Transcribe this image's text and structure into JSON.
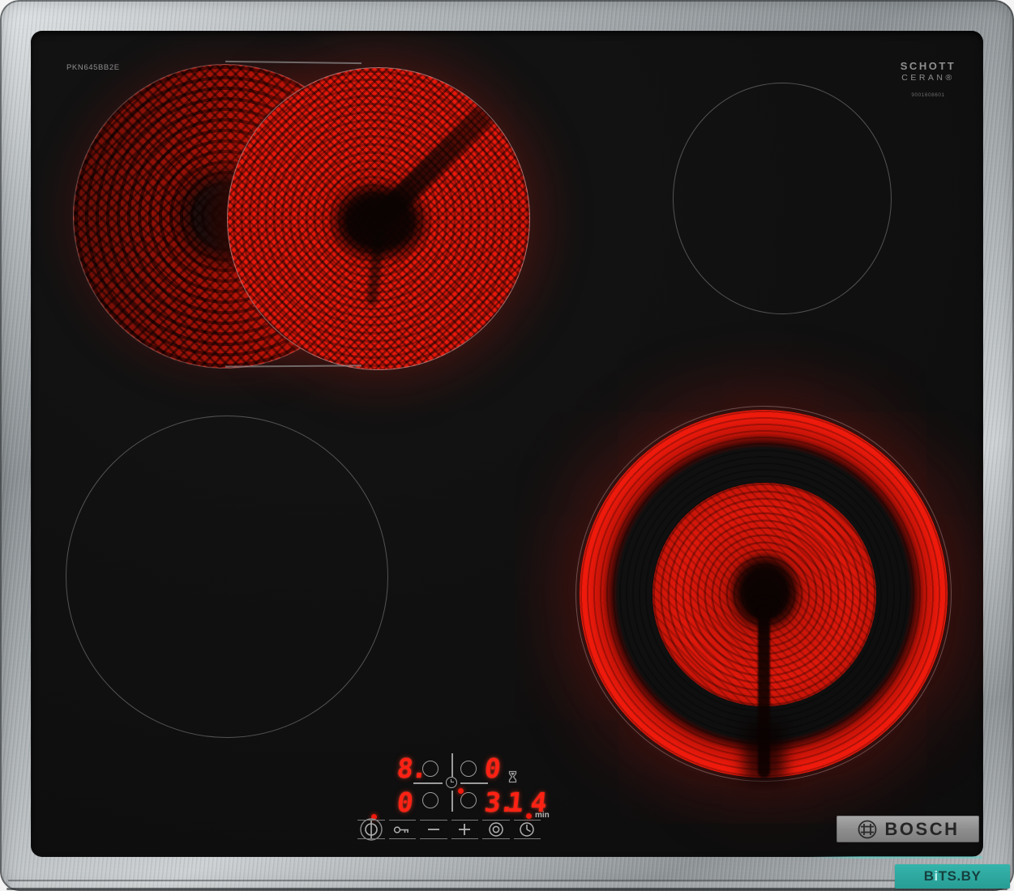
{
  "device": {
    "model_label": "PKN645BB2E",
    "schott": {
      "line1": "SCHOTT",
      "line2": "CERAN®",
      "code": "9001608601"
    },
    "brand": "BOSCH",
    "watermark": {
      "b": "B",
      "i": "i",
      "rest": "TS.BY"
    }
  },
  "display": {
    "rear_left_level": "8.",
    "rear_right_level": "0",
    "front_left_level": "0",
    "front_right_level": "3.",
    "timer_minutes": "14",
    "timer_unit": "min"
  },
  "controls": {
    "buttons": [
      {
        "id": "power",
        "icon": "power-icon"
      },
      {
        "id": "child-lock",
        "icon": "key-icon"
      },
      {
        "id": "minus",
        "icon": "minus-icon"
      },
      {
        "id": "plus",
        "icon": "plus-icon"
      },
      {
        "id": "dual-zone",
        "icon": "dual-zone-icon"
      },
      {
        "id": "timer",
        "icon": "clock-icon"
      }
    ]
  },
  "colors": {
    "glow_red": "#e8170b",
    "digit_red": "#ff2113",
    "indicator_red": "#f0190c",
    "outline_gray": "#8d8d8d",
    "watermark_teal": "#2da9a1",
    "steel_light": "#c9cdd0",
    "steel_dark": "#878d90"
  }
}
